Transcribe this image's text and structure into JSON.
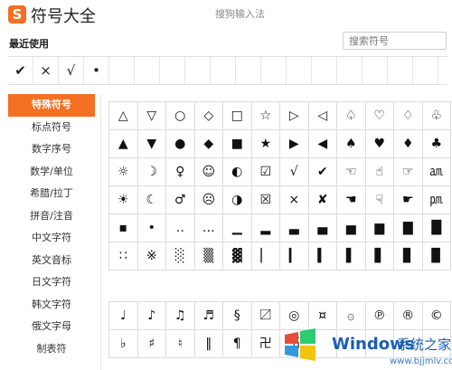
{
  "header": {
    "logo_char": "S",
    "title": "符号大全",
    "ime_name": "搜狗输入法"
  },
  "recent": {
    "label": "最近使用",
    "items": [
      "✔",
      "×",
      "√",
      "•",
      "",
      "",
      "",
      "",
      "",
      "",
      "",
      "",
      "",
      "",
      "",
      "",
      ""
    ]
  },
  "search": {
    "placeholder": "搜索符号"
  },
  "sidebar": {
    "items": [
      {
        "label": "特殊符号",
        "active": true
      },
      {
        "label": "标点符号"
      },
      {
        "label": "数字序号"
      },
      {
        "label": "数学/单位"
      },
      {
        "label": "希腊/拉丁"
      },
      {
        "label": "拼音/注音"
      },
      {
        "label": "中文字符"
      },
      {
        "label": "英文音标"
      },
      {
        "label": "日文字符"
      },
      {
        "label": "韩文字符"
      },
      {
        "label": "俄文字母"
      },
      {
        "label": "制表符"
      }
    ]
  },
  "grid_special": [
    [
      "△",
      "▽",
      "○",
      "◇",
      "□",
      "☆",
      "▷",
      "◁",
      "♤",
      "♡",
      "♢",
      "♧"
    ],
    [
      "▲",
      "▼",
      "●",
      "◆",
      "■",
      "★",
      "▶",
      "◀",
      "♠",
      "♥",
      "♦",
      "♣"
    ],
    [
      "☼",
      "☽",
      "♀",
      "☺",
      "◐",
      "☑",
      "√",
      "✔",
      "☜",
      "☝",
      "☞",
      "㏂"
    ],
    [
      "☀",
      "☾",
      "♂",
      "☹",
      "◑",
      "☒",
      "×",
      "✘",
      "☚",
      "☟",
      "☛",
      "㏘"
    ],
    [
      "▪",
      "•",
      "‥",
      "…",
      "▁",
      "▂",
      "▃",
      "▄",
      "▅",
      "▆",
      "▇",
      "█"
    ],
    [
      "∷",
      "※",
      "░",
      "▒",
      "▓",
      "▏",
      "▎",
      "▍",
      "▌",
      "▋",
      "▊",
      "▉"
    ]
  ],
  "grid_more": [
    [
      "♩",
      "♪",
      "♫",
      "♬",
      "§",
      "〼",
      "◎",
      "¤",
      "۞",
      "℗",
      "®",
      "©"
    ],
    [
      "♭",
      "♯",
      "♮",
      "‖",
      "¶",
      "卍",
      "卐",
      "",
      "",
      "",
      "",
      ""
    ]
  ],
  "watermark": {
    "brand": "Windows",
    "suffix": "系统之家",
    "url": "www.bjjmlv.com"
  }
}
